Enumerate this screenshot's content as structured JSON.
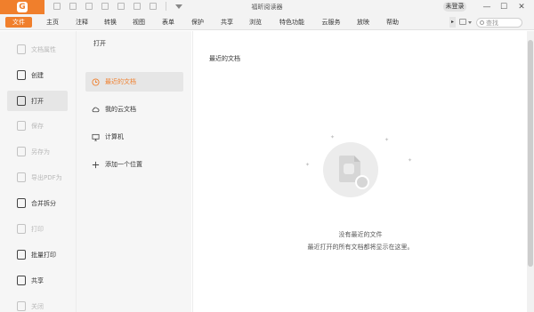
{
  "app": {
    "title": "福昕阅读器",
    "login_label": "未登录",
    "logo_text": "G"
  },
  "window_controls": {
    "minimize": "—",
    "maximize": "☐",
    "close": "✕"
  },
  "menu": {
    "file": "文件",
    "items": [
      "主页",
      "注释",
      "转换",
      "视图",
      "表单",
      "保护",
      "共享",
      "浏览",
      "特色功能",
      "云服务",
      "放映",
      "帮助"
    ],
    "collapse_arrow": "▸",
    "search_placeholder": "查找"
  },
  "sidebar": {
    "items": [
      {
        "label": "文档属性",
        "enabled": false,
        "icon": "document-properties-icon"
      },
      {
        "label": "创建",
        "enabled": true,
        "icon": "create-icon"
      },
      {
        "label": "打开",
        "enabled": true,
        "active": true,
        "icon": "open-icon"
      },
      {
        "label": "保存",
        "enabled": false,
        "icon": "save-icon"
      },
      {
        "label": "另存为",
        "enabled": false,
        "icon": "save-as-icon"
      },
      {
        "label": "导出PDF为",
        "enabled": false,
        "icon": "export-pdf-icon"
      },
      {
        "label": "合并拆分",
        "enabled": true,
        "icon": "merge-split-icon"
      },
      {
        "label": "打印",
        "enabled": false,
        "icon": "print-icon"
      },
      {
        "label": "批量打印",
        "enabled": true,
        "icon": "batch-print-icon"
      },
      {
        "label": "共享",
        "enabled": true,
        "icon": "share-icon"
      },
      {
        "label": "关闭",
        "enabled": false,
        "icon": "close-doc-icon"
      }
    ]
  },
  "open_panel": {
    "title": "打开",
    "locations": [
      {
        "label": "最近的文档",
        "active": true,
        "icon": "clock-icon"
      },
      {
        "label": "我的云文档",
        "icon": "cloud-icon"
      },
      {
        "label": "计算机",
        "icon": "computer-icon"
      },
      {
        "label": "添加一个位置",
        "icon": "plus-icon"
      }
    ]
  },
  "main": {
    "section_title": "最近的文档",
    "empty_title": "没有最近的文件",
    "empty_description": "最近打开的所有文档都将显示在这里。"
  },
  "colors": {
    "accent": "#f07f2c",
    "sidebar_bg": "#f6f6f6",
    "titlebar_bg": "#f3f3f3"
  }
}
